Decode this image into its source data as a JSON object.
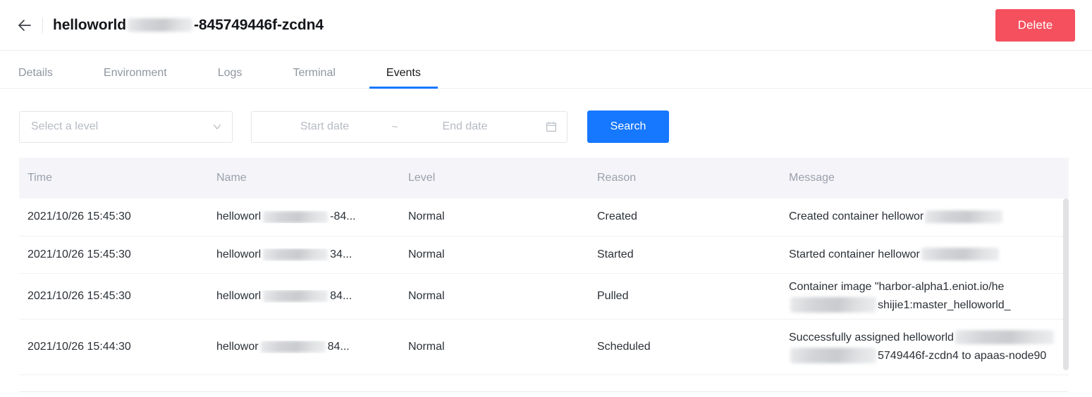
{
  "header": {
    "back_icon": "arrow-left-icon",
    "title_prefix": "helloworld",
    "title_suffix": "-845749446f-zcdn4",
    "delete_label": "Delete",
    "delete_color": "#f4505e"
  },
  "tabs": {
    "active_index": 4,
    "accent_color": "#1677ff",
    "items": [
      {
        "label": "Details"
      },
      {
        "label": "Environment"
      },
      {
        "label": "Logs"
      },
      {
        "label": "Terminal"
      },
      {
        "label": "Events"
      }
    ]
  },
  "filters": {
    "level": {
      "placeholder": "Select a level",
      "value": "",
      "icon": "chevron-down-icon"
    },
    "date_range": {
      "start_placeholder": "Start date",
      "separator": "~",
      "end_placeholder": "End date",
      "start_value": "",
      "end_value": "",
      "icon": "calendar-icon"
    },
    "search_label": "Search",
    "search_color": "#1677ff"
  },
  "table": {
    "columns": [
      "Time",
      "Name",
      "Level",
      "Reason",
      "Message"
    ],
    "header_bg": "#f5f5f9",
    "rows": [
      {
        "time": "2021/10/26 15:45:30",
        "name_prefix": "helloworl",
        "name_suffix": "-84...",
        "level": "Normal",
        "reason": "Created",
        "message_lines": [
          {
            "before": "Created container hellowor",
            "after": ""
          }
        ]
      },
      {
        "time": "2021/10/26 15:45:30",
        "name_prefix": "helloworl",
        "name_suffix": "34...",
        "level": "Normal",
        "reason": "Started",
        "message_lines": [
          {
            "before": "Started container hellowor",
            "after": ""
          }
        ]
      },
      {
        "time": "2021/10/26 15:45:30",
        "name_prefix": "helloworl",
        "name_suffix": "84...",
        "level": "Normal",
        "reason": "Pulled",
        "message_lines": [
          {
            "before": "Container image \"harbor-alpha1.eniot.io/he",
            "after": ""
          },
          {
            "before": "",
            "after": "shijie1:master_helloworld_"
          }
        ]
      },
      {
        "time": "2021/10/26 15:44:30",
        "name_prefix": "hellowor",
        "name_suffix": "84...",
        "level": "Normal",
        "reason": "Scheduled",
        "message_lines": [
          {
            "before": "Successfully assigned helloworld",
            "after": ""
          },
          {
            "before": "",
            "after": "5749446f-zcdn4 to apaas-node90"
          }
        ]
      }
    ],
    "scrollbar": {
      "name": "vertical-scrollbar"
    }
  }
}
